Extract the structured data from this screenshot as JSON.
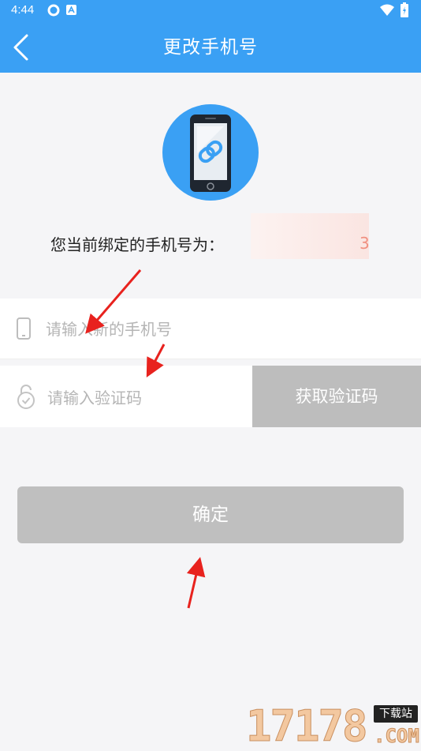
{
  "status_bar": {
    "time": "4:44"
  },
  "header": {
    "title": "更改手机号"
  },
  "current_phone": {
    "label": "您当前绑定的手机号为：",
    "masked_tail": "3"
  },
  "form": {
    "phone_placeholder": "请输入新的手机号",
    "code_placeholder": "请输入验证码",
    "get_code_label": "获取验证码"
  },
  "confirm_label": "确定",
  "watermark": {
    "number": "17178",
    "badge": "下载站",
    "suffix": ".COM"
  },
  "colors": {
    "primary": "#3aa0f4",
    "disabled": "#bdbdbd",
    "annotation": "#e8221e"
  }
}
